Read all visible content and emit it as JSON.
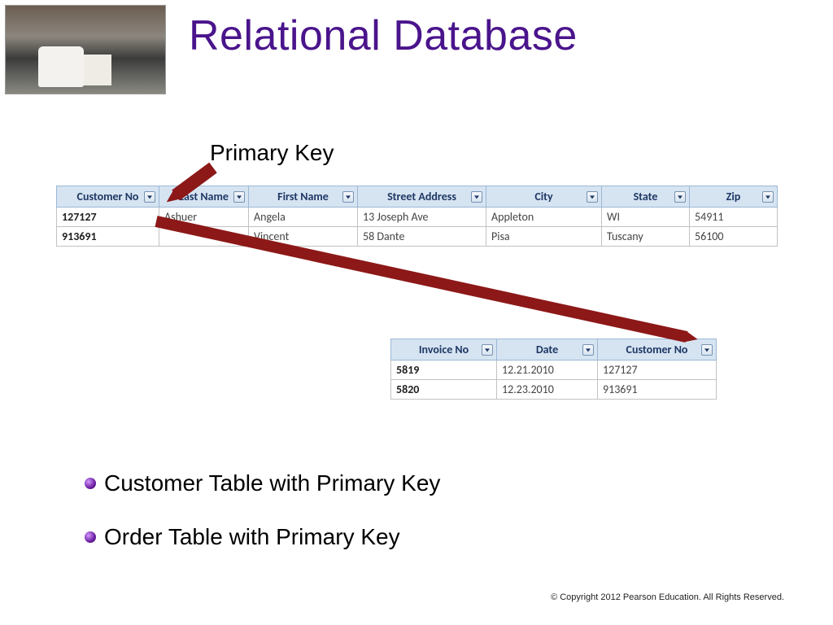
{
  "title": "Relational Database",
  "primary_key_label": "Primary Key",
  "customer_table": {
    "headers": [
      "Customer No",
      "Last Name",
      "First Name",
      "Street Address",
      "City",
      "State",
      "Zip"
    ],
    "rows": [
      [
        "127127",
        "Ashuer",
        "Angela",
        "13 Joseph Ave",
        "Appleton",
        "WI",
        "54911"
      ],
      [
        "913691",
        "",
        "Vincent",
        "58 Dante",
        "Pisa",
        "Tuscany",
        "56100"
      ]
    ]
  },
  "order_table": {
    "headers": [
      "Invoice No",
      "Date",
      "Customer No"
    ],
    "rows": [
      [
        "5819",
        "12.21.2010",
        "127127"
      ],
      [
        "5820",
        "12.23.2010",
        "913691"
      ]
    ]
  },
  "bullets": [
    "Customer Table with Primary Key",
    "Order Table with Primary Key"
  ],
  "footer": "© Copyright 2012 Pearson Education. All Rights Reserved."
}
